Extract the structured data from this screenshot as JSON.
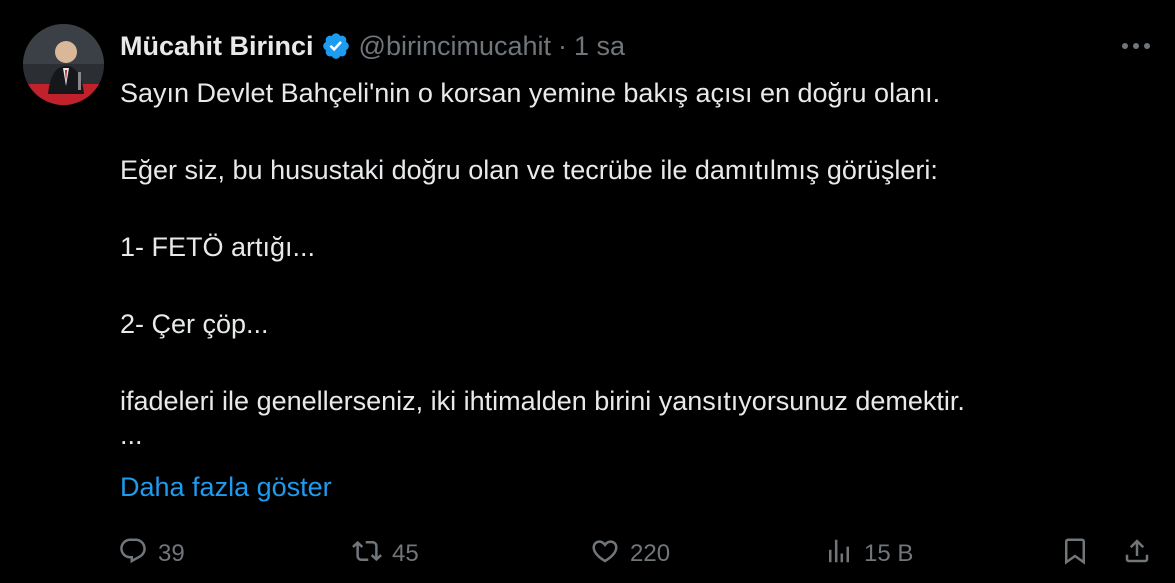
{
  "author": {
    "name": "Mücahit Birinci",
    "handle": "@birincimucahit",
    "time": "1 sa",
    "separator": "·"
  },
  "tweet": {
    "lines": [
      "Sayın Devlet Bahçeli'nin o korsan yemine bakış açısı en doğru olanı.",
      "Eğer siz, bu husustaki doğru olan ve tecrübe ile damıtılmış görüşleri:",
      "1- FETÖ artığı...",
      "2- Çer çöp...",
      "ifadeleri ile genellerseniz, iki ihtimalden birini yansıtıyorsunuz demektir.",
      "..."
    ],
    "show_more": "Daha fazla göster"
  },
  "actions": {
    "reply_count": "39",
    "retweet_count": "45",
    "like_count": "220",
    "views_count": "15 B"
  },
  "icons": {
    "verified": "verified-badge-icon",
    "more": "more-horizontal-icon",
    "reply": "reply-icon",
    "retweet": "retweet-icon",
    "like": "heart-icon",
    "views": "views-icon",
    "bookmark": "bookmark-icon",
    "share": "share-icon"
  },
  "colors": {
    "background": "#000000",
    "text": "#e7e9ea",
    "secondary": "#71767b",
    "accent": "#1d9bf0"
  }
}
